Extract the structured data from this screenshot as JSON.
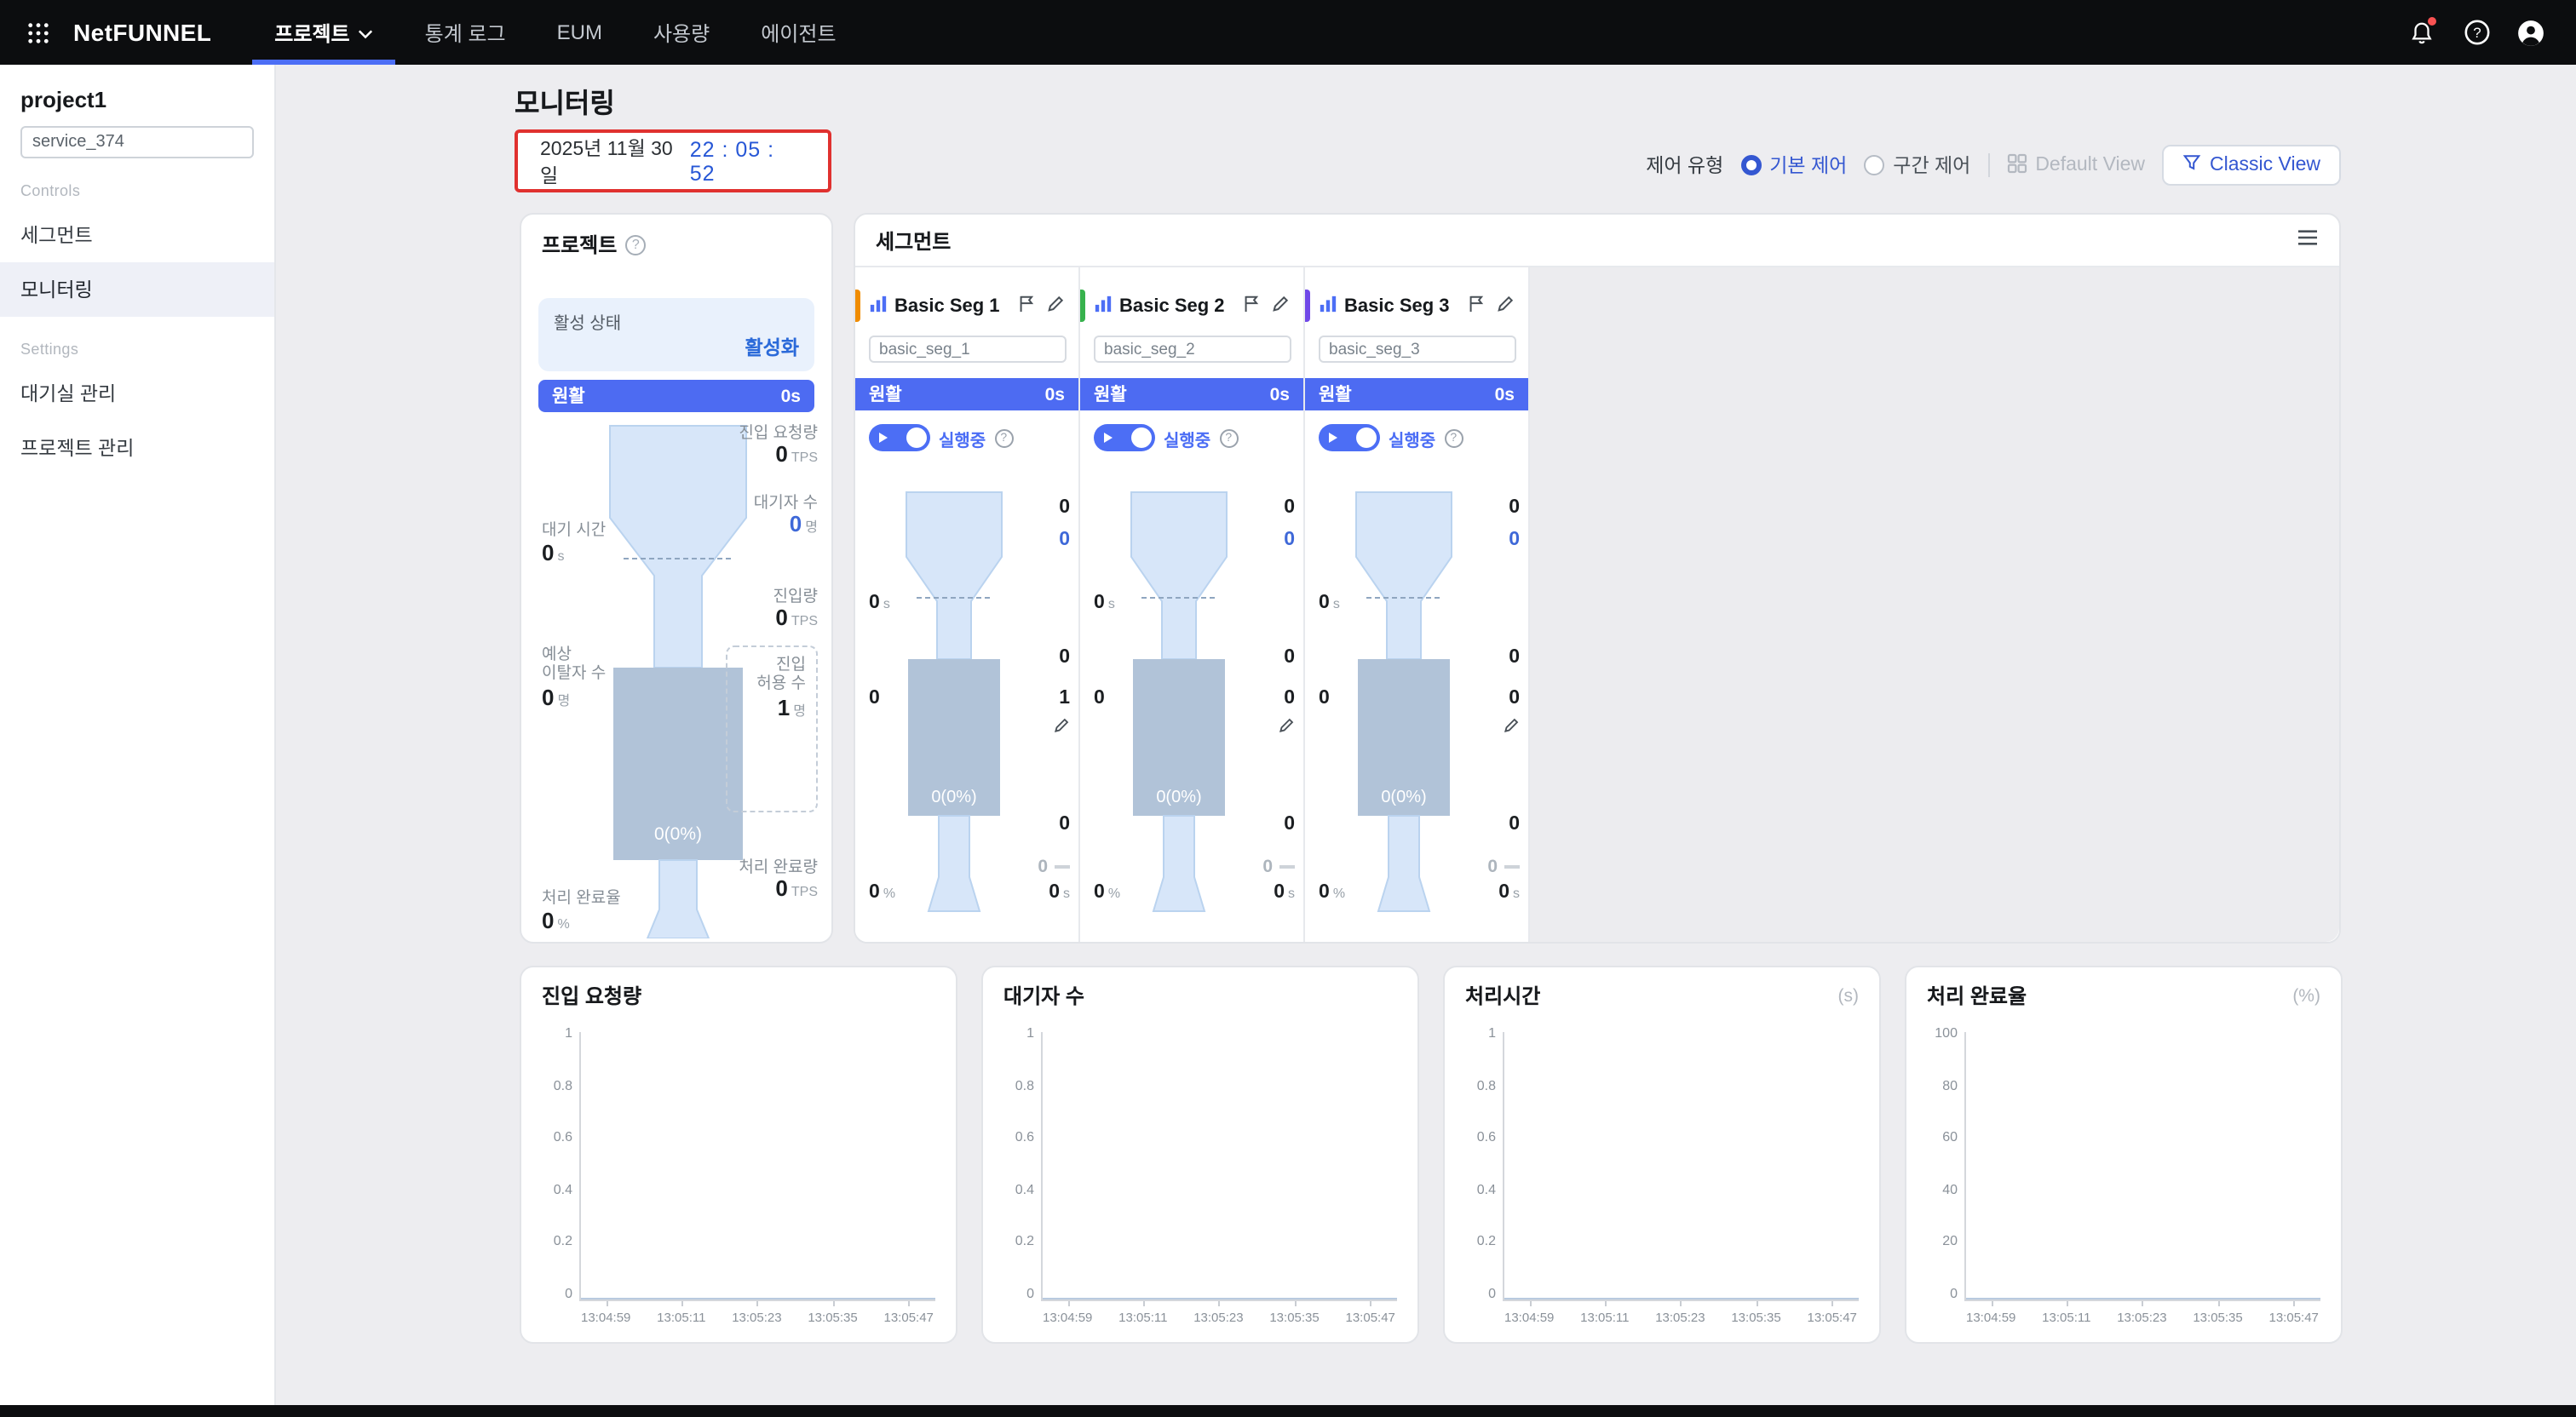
{
  "navbar": {
    "brand": "NetFUNNEL",
    "items": [
      "프로젝트",
      "통계 로그",
      "EUM",
      "사용량",
      "에이전트"
    ]
  },
  "sidebar": {
    "project": "project1",
    "service": "service_374",
    "controls_label": "Controls",
    "settings_label": "Settings",
    "menu_segment": "세그먼트",
    "menu_monitoring": "모니터링",
    "menu_waiting_room": "대기실 관리",
    "menu_project_mgmt": "프로젝트 관리"
  },
  "header": {
    "title": "모니터링",
    "date": "2025년 11월 30일",
    "time": "22 : 05 : 52",
    "control_type": "제어 유형",
    "radio_basic": "기본 제어",
    "radio_range": "구간 제어",
    "default_view": "Default View",
    "classic_view": "Classic View"
  },
  "colors": {
    "accent": "#4c6ef5",
    "alert_border": "#e0312f",
    "time_text": "#2757d6"
  },
  "project": {
    "title": "프로젝트",
    "status_label": "활성 상태",
    "status_value": "활성화",
    "flow_label": "원활",
    "flow_time": "0s",
    "inflow_request_label": "진입 요청량",
    "inflow_request_value": "0",
    "inflow_request_unit": "TPS",
    "waiting_label": "대기자 수",
    "waiting_value": "0",
    "waiting_unit": "명",
    "wait_time_label": "대기 시간",
    "wait_time_value": "0",
    "wait_time_unit": "s",
    "inflow_label": "진입량",
    "inflow_value": "0",
    "inflow_unit": "TPS",
    "leave_label_1": "예상",
    "leave_label_2": "이탈자 수",
    "leave_value": "0",
    "leave_unit": "명",
    "allow_label_1": "진입",
    "allow_label_2": "허용 수",
    "allow_value": "1",
    "allow_unit": "명",
    "funnel_center": "0(0%)",
    "done_label": "처리 완료량",
    "done_value": "0",
    "done_unit": "TPS",
    "rate_label": "처리 완료율",
    "rate_value": "0",
    "rate_unit": "%"
  },
  "segments": {
    "title": "세그먼트",
    "items": [
      {
        "name": "Basic Seg 1",
        "key": "basic_seg_1",
        "tag_color": "#f08c00",
        "flow_label": "원활",
        "flow_time": "0s",
        "running_label": "실행중",
        "inflow_request": "0",
        "waiting": "0",
        "wait_time": "0",
        "wait_time_unit": "s",
        "inflow": "0",
        "leave": "0",
        "allow": "1",
        "funnel_center": "0(0%)",
        "done": "0",
        "queue": "0",
        "rate": "0",
        "rate_unit": "%",
        "proc": "0",
        "proc_unit": "s"
      },
      {
        "name": "Basic Seg 2",
        "key": "basic_seg_2",
        "tag_color": "#37b24d",
        "flow_label": "원활",
        "flow_time": "0s",
        "running_label": "실행중",
        "inflow_request": "0",
        "waiting": "0",
        "wait_time": "0",
        "wait_time_unit": "s",
        "inflow": "0",
        "leave": "0",
        "allow": "0",
        "funnel_center": "0(0%)",
        "done": "0",
        "queue": "0",
        "rate": "0",
        "rate_unit": "%",
        "proc": "0",
        "proc_unit": "s"
      },
      {
        "name": "Basic Seg 3",
        "key": "basic_seg_3",
        "tag_color": "#7048e8",
        "flow_label": "원활",
        "flow_time": "0s",
        "running_label": "실행중",
        "inflow_request": "0",
        "waiting": "0",
        "wait_time": "0",
        "wait_time_unit": "s",
        "inflow": "0",
        "leave": "0",
        "allow": "0",
        "funnel_center": "0(0%)",
        "done": "0",
        "queue": "0",
        "rate": "0",
        "rate_unit": "%",
        "proc": "0",
        "proc_unit": "s"
      }
    ]
  },
  "chart_data": [
    {
      "type": "line",
      "title": "진입 요청량",
      "unit": "",
      "x": [
        "13:04:59",
        "13:05:11",
        "13:05:23",
        "13:05:35",
        "13:05:47"
      ],
      "values": [
        0,
        0,
        0,
        0,
        0
      ],
      "ylim": [
        0,
        1
      ],
      "y_ticks": [
        "1",
        "0.8",
        "0.6",
        "0.4",
        "0.2",
        "0"
      ],
      "grid": false,
      "legend": "none"
    },
    {
      "type": "line",
      "title": "대기자 수",
      "unit": "",
      "x": [
        "13:04:59",
        "13:05:11",
        "13:05:23",
        "13:05:35",
        "13:05:47"
      ],
      "values": [
        0,
        0,
        0,
        0,
        0
      ],
      "ylim": [
        0,
        1
      ],
      "y_ticks": [
        "1",
        "0.8",
        "0.6",
        "0.4",
        "0.2",
        "0"
      ],
      "grid": false,
      "legend": "none"
    },
    {
      "type": "line",
      "title": "처리시간",
      "unit": "(s)",
      "x": [
        "13:04:59",
        "13:05:11",
        "13:05:23",
        "13:05:35",
        "13:05:47"
      ],
      "values": [
        0,
        0,
        0,
        0,
        0
      ],
      "ylim": [
        0,
        1
      ],
      "y_ticks": [
        "1",
        "0.8",
        "0.6",
        "0.4",
        "0.2",
        "0"
      ],
      "grid": false,
      "legend": "none"
    },
    {
      "type": "line",
      "title": "처리 완료율",
      "unit": "(%)",
      "x": [
        "13:04:59",
        "13:05:11",
        "13:05:23",
        "13:05:35",
        "13:05:47"
      ],
      "values": [
        0,
        0,
        0,
        0,
        0
      ],
      "ylim": [
        0,
        100
      ],
      "y_ticks": [
        "100",
        "80",
        "60",
        "40",
        "20",
        "0"
      ],
      "grid": false,
      "legend": "none"
    }
  ]
}
